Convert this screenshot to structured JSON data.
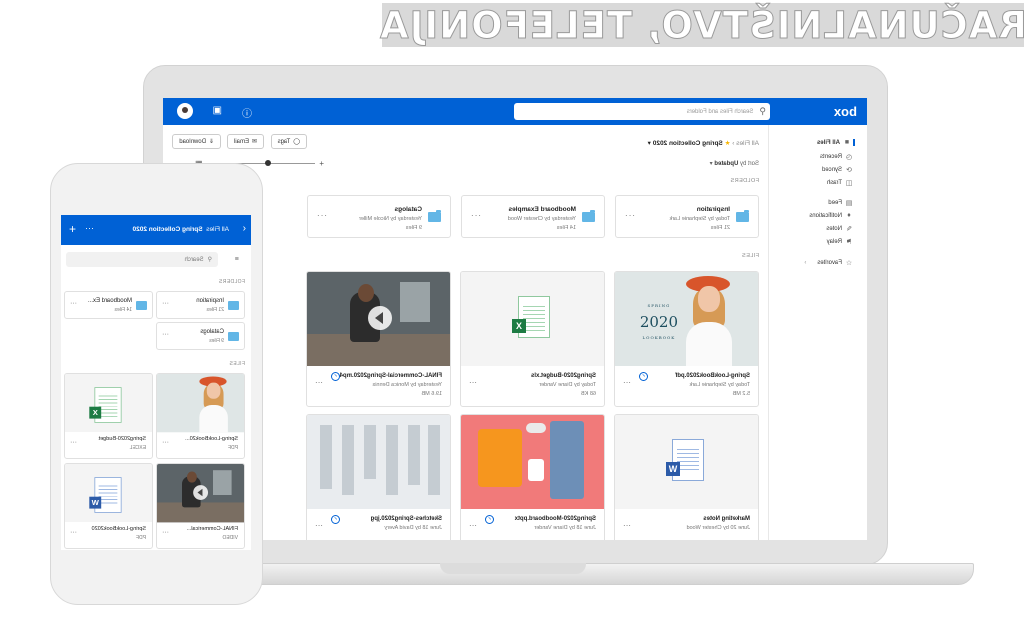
{
  "banner": {
    "text": "RAČUNALNIŠTVO, TELEFONIJA"
  },
  "colors": {
    "brand": "#0061d5",
    "folder": "#62b6e6",
    "excel": "#1d7b43",
    "word": "#2c5ba8",
    "star": "#f7b500"
  },
  "desktop": {
    "logo": "box",
    "search": {
      "placeholder": "Search Files and Folders"
    },
    "sidebar": {
      "items": [
        {
          "label": "All Files",
          "icon": "folder-icon"
        },
        {
          "label": "Recents",
          "icon": "clock-icon"
        },
        {
          "label": "Synced",
          "icon": "sync-icon"
        },
        {
          "label": "Trash",
          "icon": "trash-icon"
        },
        {
          "label": "Feed",
          "icon": "feed-icon"
        },
        {
          "label": "Notifications",
          "icon": "bell-icon"
        },
        {
          "label": "Notes",
          "icon": "notes-icon"
        },
        {
          "label": "Relay",
          "icon": "relay-icon"
        },
        {
          "label": "Favorites",
          "icon": "star-icon"
        }
      ]
    },
    "breadcrumb": {
      "root": "All Files",
      "current": "Spring Collection 2020"
    },
    "toolbar": {
      "tags": "Tags",
      "email": "Email",
      "download": "Download"
    },
    "sort": {
      "label": "Sort by",
      "value": "Updated"
    },
    "folders_label": "FOLDERS",
    "files_label": "FILES",
    "folders": [
      {
        "name": "Inspiration",
        "meta": "Today by Stephanie Lark",
        "count": "21 Files"
      },
      {
        "name": "Moodboard Examples",
        "meta": "Yesterday by Chester Wood",
        "count": "14 Files"
      },
      {
        "name": "Catalogs",
        "meta": "Yesterday by Nicole Miller",
        "count": "9 Files"
      }
    ],
    "files": [
      {
        "name": "Spring-LookBook2020.pdf",
        "meta": "Today by Stephanie Lark",
        "size": "5.2 MB",
        "kind": "photo-woman"
      },
      {
        "name": "Spring2020-Budget.xls",
        "meta": "Today by Diane Vander",
        "size": "68 KB",
        "kind": "excel"
      },
      {
        "name": "FINAL-Commercial-Spring2020.mp4",
        "meta": "Yesterday by Monica Dennis",
        "size": "19.6 MB",
        "kind": "video"
      },
      {
        "name": "Marketing Notes",
        "meta": "June 20 by Chester Wood",
        "size": "",
        "kind": "word"
      },
      {
        "name": "Spring2020-Moodboard.pptx",
        "meta": "June 18 by Diane Vander",
        "size": "",
        "kind": "flatlay"
      },
      {
        "name": "Sketches-Spring2020.jpg",
        "meta": "June 18 by David Avery",
        "size": "",
        "kind": "sketch"
      }
    ],
    "spring_text": {
      "line1": "SPRING",
      "line2": "2020",
      "line3": "LOOKBOOK"
    }
  },
  "mobile": {
    "header": {
      "root": "All Files",
      "current": "Spring Collection 2020"
    },
    "search": {
      "placeholder": "Search"
    },
    "folders_label": "FOLDERS",
    "files_label": "FILES",
    "folders": [
      {
        "name": "Inspiration",
        "count": "21 Files"
      },
      {
        "name": "Moodboard Ex...",
        "count": "14 Files"
      },
      {
        "name": "Catalogs",
        "count": "9 Files"
      }
    ],
    "files": [
      {
        "name": "Spring-LookBook20...",
        "meta": "PDF"
      },
      {
        "name": "Spring2020-Budget",
        "meta": "EXCEL"
      },
      {
        "name": "FINAL-Commerical...",
        "meta": "VIDEO"
      },
      {
        "name": "Spring-LookBook2020",
        "meta": "PDF"
      }
    ]
  }
}
